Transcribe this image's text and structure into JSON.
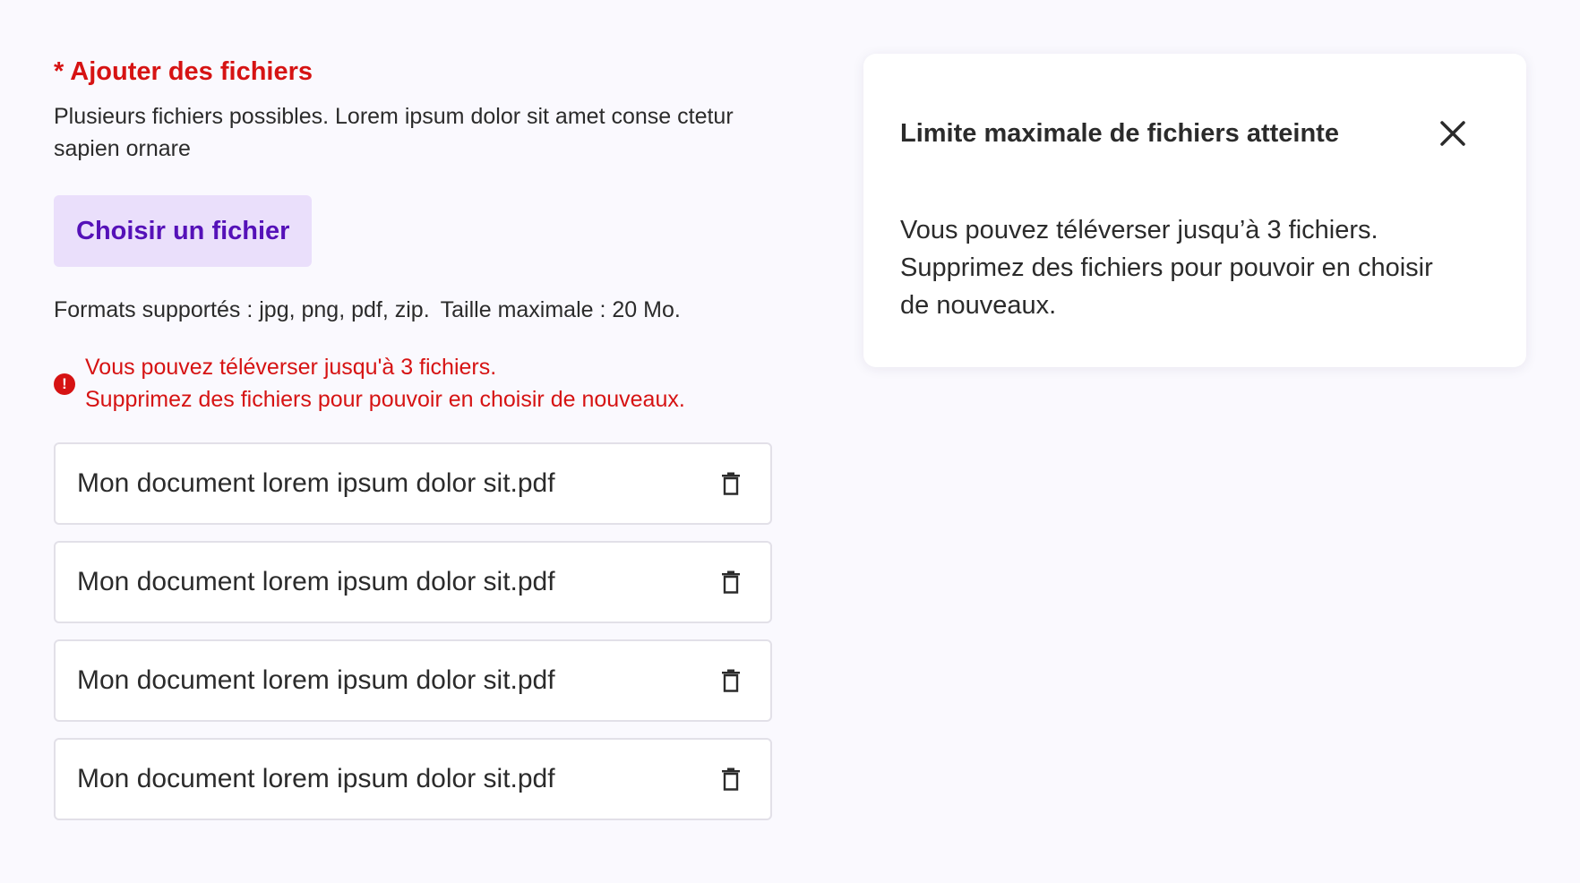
{
  "upload": {
    "label": "* Ajouter des fichiers",
    "help": "Plusieurs fichiers possibles. Lorem ipsum dolor sit amet conse ctetur sapien ornare",
    "choose_button": "Choisir un fichier",
    "formats": "Formats supportés : jpg, png, pdf, zip.",
    "max_size": "Taille maximale : 20 Mo.",
    "error_line1": "Vous pouvez téléverser jusqu'à 3 fichiers.",
    "error_line2": "Supprimez des fichiers pour pouvoir en choisir de nouveaux.",
    "error_icon": "!",
    "files": [
      {
        "name": "Mon document lorem ipsum dolor sit.pdf"
      },
      {
        "name": "Mon document lorem ipsum dolor sit.pdf"
      },
      {
        "name": "Mon document lorem ipsum dolor sit.pdf"
      },
      {
        "name": "Mon document lorem ipsum dolor sit.pdf"
      }
    ]
  },
  "modal": {
    "title": "Limite maximale de fichiers atteinte",
    "body_line1": "Vous pouvez téléverser jusqu’à 3 fichiers.",
    "body_line2": "Supprimez des fichiers pour pouvoir en choisir",
    "body_line3": "de nouveaux."
  },
  "icons": {
    "trash": "trash-icon",
    "close": "close-icon",
    "error": "error-icon"
  },
  "colors": {
    "background": "#faf9fe",
    "error": "#d61313",
    "button_bg": "#eadffb",
    "button_text": "#5511b8",
    "text": "#2b2b2b",
    "border": "#e2e0e8"
  }
}
